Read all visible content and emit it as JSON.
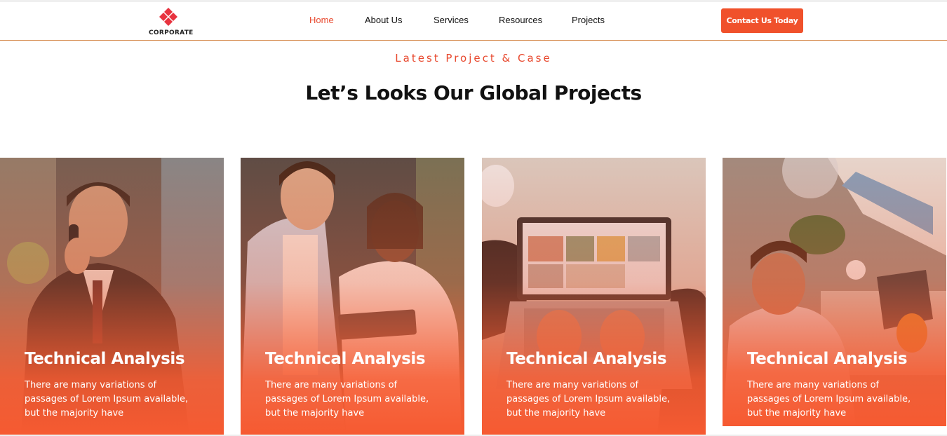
{
  "brand": {
    "name": "CORPORATE",
    "color": "#e8492f"
  },
  "nav": {
    "items": [
      {
        "label": "Home",
        "active": true
      },
      {
        "label": "About Us",
        "active": false
      },
      {
        "label": "Services",
        "active": false
      },
      {
        "label": "Resources",
        "active": false
      },
      {
        "label": "Projects",
        "active": false
      }
    ],
    "cta_label": "Contact Us Today"
  },
  "section": {
    "subtitle": "Latest Project & Case",
    "title": "Let’s Looks Our Global Projects"
  },
  "cards": [
    {
      "title": "Technical Analysis",
      "description": "There are many variations of passages of Lorem Ipsum available, but the majority have",
      "image": "man-on-phone"
    },
    {
      "title": "Technical Analysis",
      "description": "There are many variations of passages of Lorem Ipsum available, but the majority have",
      "image": "colleagues-with-tablet"
    },
    {
      "title": "Technical Analysis",
      "description": "There are many variations of passages of Lorem Ipsum available, but the majority have",
      "image": "laptop-typing"
    },
    {
      "title": "Technical Analysis",
      "description": "There are many variations of passages of Lorem Ipsum available, but the majority have",
      "image": "man-at-desk"
    }
  ],
  "colors": {
    "accent": "#f0512b",
    "overlay": "#f65a31"
  }
}
